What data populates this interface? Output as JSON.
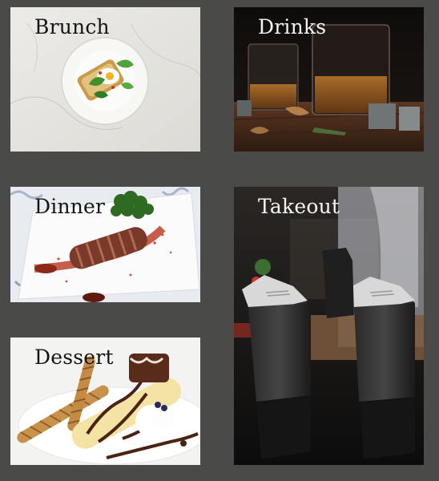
{
  "categories": {
    "brunch": {
      "label": "Brunch"
    },
    "drinks": {
      "label": "Drinks"
    },
    "dinner": {
      "label": "Dinner"
    },
    "takeout": {
      "label": "Takeout"
    },
    "dessert": {
      "label": "Dessert"
    }
  }
}
